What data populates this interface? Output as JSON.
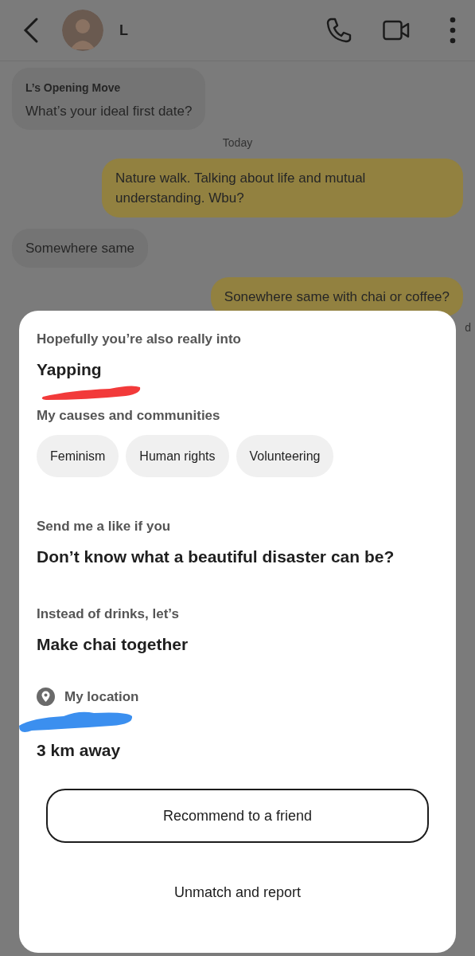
{
  "header": {
    "name": "L"
  },
  "messages": [
    {
      "kind": "opening_move",
      "label": "L’s Opening Move",
      "text": "What’s your ideal first date?"
    },
    {
      "kind": "date",
      "text": "Today"
    },
    {
      "kind": "sent",
      "text": "Nature walk. Talking about life and mutual understanding. Wbu?"
    },
    {
      "kind": "received",
      "text": "Somewhere same"
    },
    {
      "kind": "sent",
      "text": "Sonewhere same with chai or coffee?"
    }
  ],
  "status": "d",
  "profile_sheet": {
    "sections": [
      {
        "kind": "interest",
        "label": "Hopefully you’re also really into",
        "value": "Yapping"
      },
      {
        "kind": "chips",
        "label": "My causes and communities",
        "chips": [
          "Feminism",
          "Human rights",
          "Volunteering"
        ]
      },
      {
        "kind": "prompt",
        "label": "Send me a like if you",
        "value": "Don’t know what a beautiful disaster can be?"
      },
      {
        "kind": "prompt",
        "label": "Instead of drinks, let’s",
        "value": "Make chai together"
      },
      {
        "kind": "location",
        "label": "My location",
        "value": "3 km away"
      }
    ],
    "buttons": [
      {
        "kind": "outlined",
        "label": "Recommend to a friend"
      },
      {
        "kind": "plain",
        "label": "Unmatch and report"
      }
    ]
  }
}
